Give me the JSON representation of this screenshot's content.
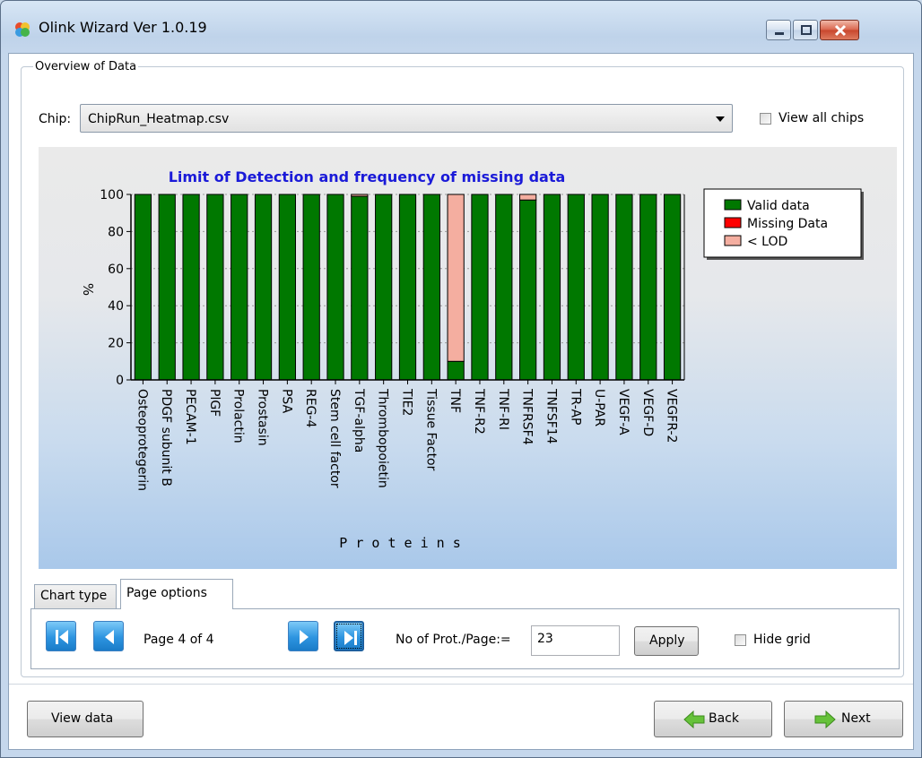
{
  "window": {
    "title": "Olink Wizard Ver 1.0.19"
  },
  "group": {
    "title": "Overview of Data"
  },
  "chip": {
    "label": "Chip:",
    "selected": "ChipRun_Heatmap.csv",
    "view_all_label": "View all chips",
    "view_all_checked": false
  },
  "chart_data": {
    "type": "bar",
    "stacked": true,
    "title": "Limit of Detection and frequency of missing data",
    "xlabel": "P r o t e i n s",
    "ylabel": "%",
    "ylim": [
      0,
      100
    ],
    "yticks": [
      0,
      20,
      40,
      60,
      80,
      100
    ],
    "legend_position": "top-right",
    "categories": [
      "Osteoprotegerin",
      "PDGF subunit B",
      "PECAM-1",
      "PlGF",
      "Prolactin",
      "Prostasin",
      "PSA",
      "REG-4",
      "Stem cell factor",
      "TGF-alpha",
      "Thrombopoietin",
      "TIE2",
      "Tissue Factor",
      "TNF",
      "TNF-R2",
      "TNF-RI",
      "TNFRSF4",
      "TNFSF14",
      "TR-AP",
      "U-PAR",
      "VEGF-A",
      "VEGF-D",
      "VEGFR-2"
    ],
    "series": [
      {
        "name": "Valid data",
        "color": "#007800",
        "values": [
          100,
          100,
          100,
          100,
          100,
          100,
          100,
          100,
          100,
          99,
          100,
          100,
          100,
          10,
          100,
          100,
          97,
          100,
          100,
          100,
          100,
          100,
          100
        ]
      },
      {
        "name": "Missing Data",
        "color": "#ff0000",
        "values": [
          0,
          0,
          0,
          0,
          0,
          0,
          0,
          0,
          0,
          0,
          0,
          0,
          0,
          0,
          0,
          0,
          0,
          0,
          0,
          0,
          0,
          0,
          0
        ]
      },
      {
        "name": "< LOD",
        "color": "#f4aea0",
        "values": [
          0,
          0,
          0,
          0,
          0,
          0,
          0,
          0,
          0,
          1,
          0,
          0,
          0,
          90,
          0,
          0,
          3,
          0,
          0,
          0,
          0,
          0,
          0
        ]
      }
    ]
  },
  "tabs": [
    {
      "label": "Chart type",
      "active": false
    },
    {
      "label": "Page options",
      "active": true
    }
  ],
  "page_options": {
    "page_text": "Page 4 of 4",
    "per_page_label": "No of Prot./Page:=",
    "per_page_value": "23",
    "apply_label": "Apply",
    "hide_grid_label": "Hide grid",
    "hide_grid_checked": false
  },
  "footer": {
    "view_data_label": "View data",
    "back_label": "Back",
    "next_label": "Next"
  }
}
